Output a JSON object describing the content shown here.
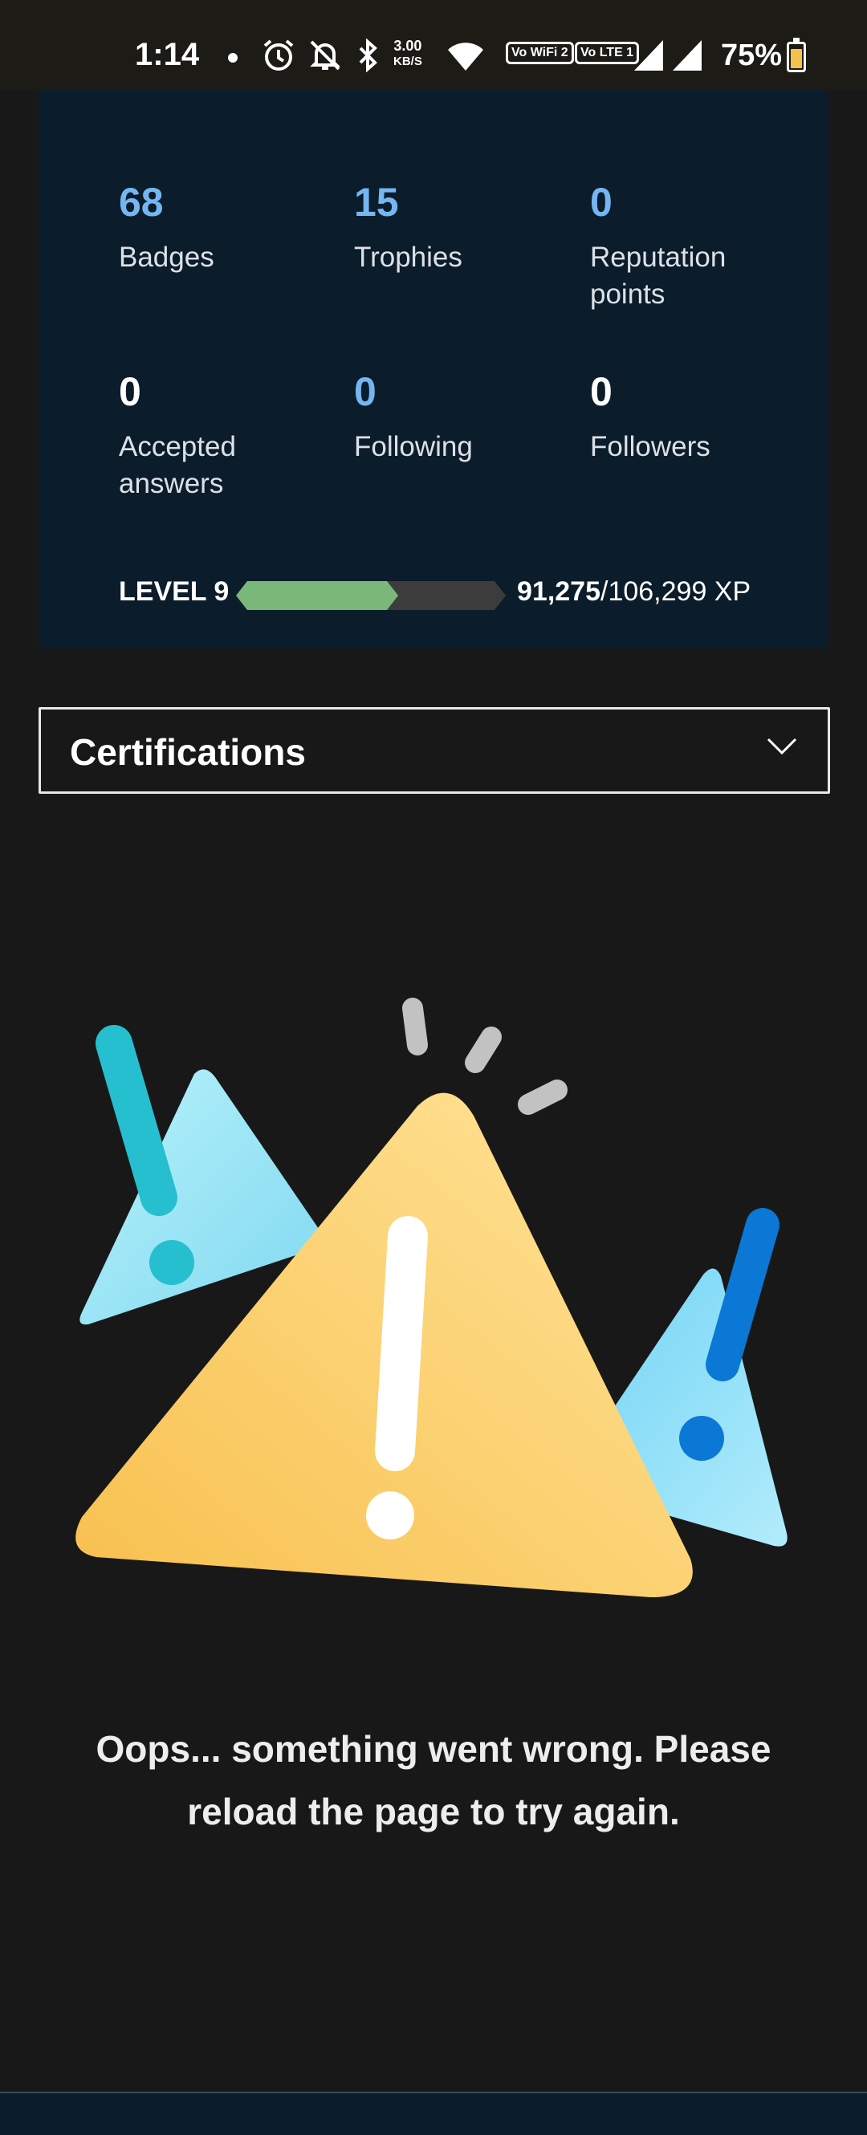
{
  "status_bar": {
    "time": "1:14",
    "speed_value": "3.00",
    "speed_unit": "KB/S",
    "vowifi_label": "Vo WiFi 2",
    "volte_label": "Vo LTE 1",
    "battery": "75%",
    "icons": [
      "alarm-icon",
      "mute-icon",
      "bluetooth-icon",
      "wifi-icon",
      "signal-icon",
      "battery-icon"
    ]
  },
  "profile_stats": {
    "stats": [
      {
        "value": "68",
        "label": "Badges",
        "color": "#75b6f2"
      },
      {
        "value": "15",
        "label": "Trophies",
        "color": "#75b6f2"
      },
      {
        "value": "0",
        "label": "Reputation points",
        "color": "#75b6f2"
      },
      {
        "value": "0",
        "label": "Accepted answers",
        "color": "#ffffff"
      },
      {
        "value": "0",
        "label": "Following",
        "color": "#75b6f2"
      },
      {
        "value": "0",
        "label": "Followers",
        "color": "#ffffff"
      }
    ],
    "level": "LEVEL 9",
    "xp_current": "91,275",
    "xp_total": "/106,299 XP",
    "xp_progress_fraction": 0.6,
    "xp_bar_fill_color": "#7ab87a",
    "xp_bar_track_color": "#3c3c3c"
  },
  "certifications": {
    "label": "Certifications",
    "icon": "chevron-down-icon"
  },
  "error": {
    "message": "Oops... something went wrong. Please reload the page to try again.",
    "illustration": "warning-triangles-illustration"
  },
  "colors": {
    "background": "#181818",
    "card": "#0b1c2b",
    "accent_blue": "#75b6f2"
  }
}
